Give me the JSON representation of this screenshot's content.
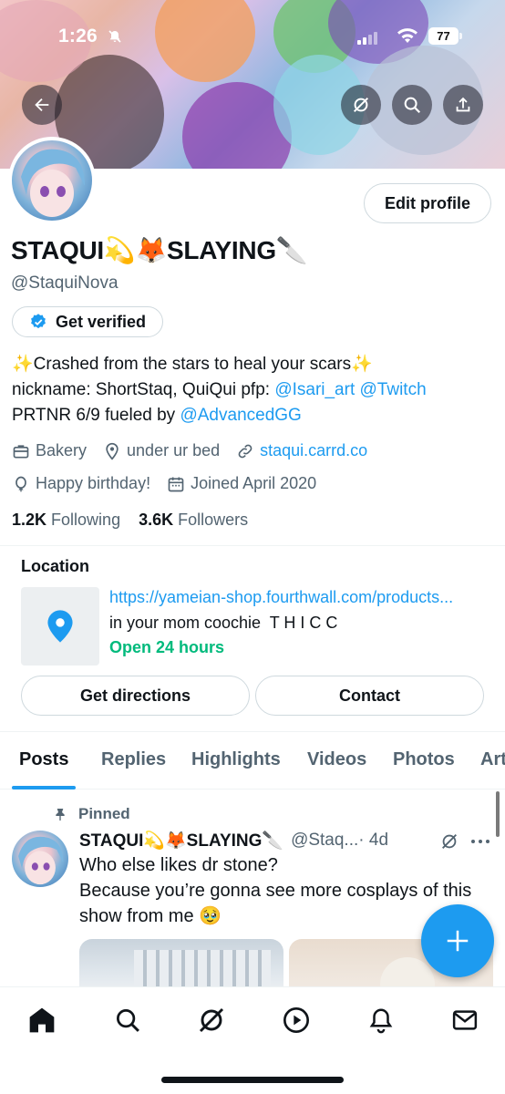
{
  "status_bar": {
    "time": "1:26",
    "battery": "77"
  },
  "header": {
    "back_icon": "arrow-left-icon",
    "grok_icon": "grok-icon",
    "search_icon": "search-icon",
    "share_icon": "share-icon"
  },
  "profile": {
    "display_name": "STAQUI💫🦊SLAYING🔪",
    "handle": "@StaquiNova",
    "edit_profile_label": "Edit profile",
    "get_verified_label": "Get verified",
    "bio": {
      "line1": "✨Crashed from the stars to heal your scars✨",
      "line2_text": "nickname: ShortStaq, QuiQui pfp: ",
      "line2_link1": "@Isari_art",
      "line2_link2": "@Twitch",
      "line3_text": "PRTNR 6/9 fueled by ",
      "line3_link": "@AdvancedGG"
    },
    "category": "Bakery",
    "location": "under ur bed",
    "website": "staqui.carrd.co",
    "birthday": "Happy birthday!",
    "joined": "Joined April 2020",
    "following_count": "1.2K",
    "following_label": "Following",
    "followers_count": "3.6K",
    "followers_label": "Followers"
  },
  "location_card": {
    "title": "Location",
    "url": "https://yameian-shop.fourthwall.com/products...",
    "description": "in your mom coochie  T H I C C",
    "hours": "Open 24 hours",
    "directions_label": "Get directions",
    "contact_label": "Contact"
  },
  "tabs": [
    {
      "label": "Posts",
      "active": true
    },
    {
      "label": "Replies"
    },
    {
      "label": "Highlights"
    },
    {
      "label": "Videos"
    },
    {
      "label": "Photos"
    },
    {
      "label": "Art"
    }
  ],
  "post": {
    "pinned_label": "Pinned",
    "name": "STAQUI💫🦊SLAYING🔪",
    "handle": "@Staq...",
    "time": "· 4d",
    "line1": "Who else likes dr stone?",
    "line2": "Because you’re gonna see more cosplays of this",
    "line3": "show from me 🥹"
  },
  "fab_label": "+",
  "bottom_nav": [
    "home-icon",
    "search-icon",
    "grok-icon",
    "video-icon",
    "notifications-icon",
    "messages-icon"
  ],
  "colors": {
    "accent": "#1d9bf0",
    "green": "#00ba7c",
    "secondary_text": "#536471",
    "primary_text": "#0f1419"
  }
}
